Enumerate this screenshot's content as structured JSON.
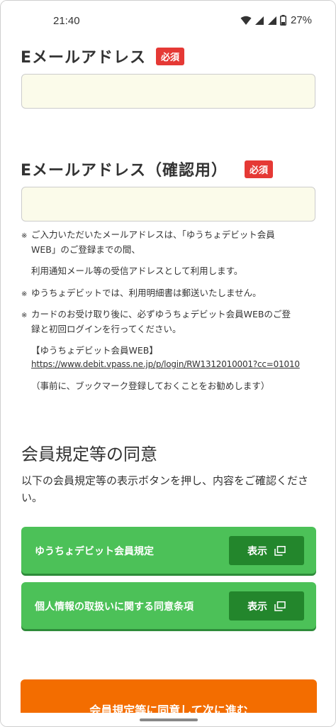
{
  "status_bar": {
    "time": "21:40",
    "battery_percent": "27%",
    "icons": [
      "wifi-icon",
      "signal-icon",
      "signal-icon",
      "battery-icon"
    ]
  },
  "email_field": {
    "label": "Eメールアドレス",
    "required_badge": "必須",
    "value": ""
  },
  "email_confirm_field": {
    "label": "Eメールアドレス（確認用）",
    "required_badge": "必須",
    "value": ""
  },
  "notes": {
    "mark": "※",
    "note1_line1": "ご入力いただいたメールアドレスは、「ゆうちょデビット会員",
    "note1_line2": "WEB」のご登録までの間、",
    "note1_line3": "利用通知メール等の受信アドレスとして利用します。",
    "note2": "ゆうちょデビットでは、利用明細書は郵送いたしません。",
    "note3_line1": "カードのお受け取り後に、必ずゆうちょデビット会員WEBのご登",
    "note3_line2": "録と初回ログインを行ってください。",
    "member_web_heading": "【ゆうちょデビット会員WEB】",
    "member_web_link": "https://www.debit.vpass.ne.jp/p/login/RW1312010001?cc=01010",
    "bookmark_note": "（事前に、ブックマーク登録しておくことをお勧めします）"
  },
  "consent_section": {
    "title": "会員規定等の同意",
    "description": "以下の会員規定等の表示ボタンを押し、内容をご確認ください。",
    "items": [
      {
        "label": "ゆうちょデビット会員規定",
        "button_label": "表示"
      },
      {
        "label": "個人情報の取扱いに関する同意条項",
        "button_label": "表示"
      }
    ]
  },
  "submit": {
    "label": "会員規定等に同意して次に進む"
  },
  "colors": {
    "required_badge": "#e53935",
    "input_background": "#fbfbea",
    "green_row": "#4cc158",
    "show_button": "#23862c",
    "submit_button": "#f36d00"
  }
}
